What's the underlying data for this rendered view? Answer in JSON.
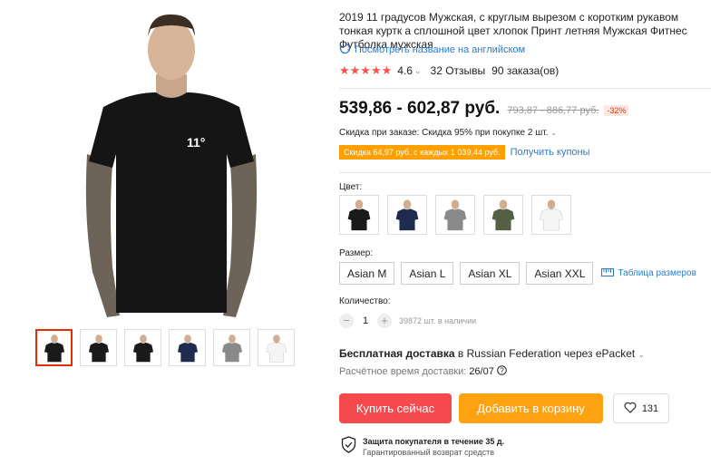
{
  "product": {
    "title": "2019 11 градусов Мужская, с круглым вырезом с коротким рукавом тонкая куртк а сплошной цвет хлопок Принт летняя Мужская Фитнес Футболка мужская",
    "translate_link": "Посмотреть название на английском",
    "stars": "★★★★★",
    "rating": "4.6",
    "reviews": "32 Отзывы",
    "orders": "90 заказа(ов)",
    "price": "539,86 - 602,87 руб.",
    "old_price": "793,87 - 886,77 руб.",
    "discount": "-32%",
    "logo_text": "11°"
  },
  "promo": {
    "bulk_discount": "Скидка при заказе: Скидка 95% при покупке 2 шт.",
    "coupon_tag": "Скидка 64,97 руб. с каждых 1 039,44 руб.",
    "coupon_link": "Получить купоны"
  },
  "options": {
    "color_label": "Цвет:",
    "colors": [
      {
        "name": "black",
        "shirt": "#1a1a1a"
      },
      {
        "name": "navy",
        "shirt": "#1e2b4f"
      },
      {
        "name": "grey",
        "shirt": "#8a8a8a"
      },
      {
        "name": "olive",
        "shirt": "#556043"
      },
      {
        "name": "white",
        "shirt": "#f5f5f5"
      }
    ],
    "size_label": "Размер:",
    "sizes": [
      "Asian M",
      "Asian L",
      "Asian XL",
      "Asian XXL"
    ],
    "size_table": "Таблица размеров",
    "qty_label": "Количество:",
    "qty_value": "1",
    "qty_minus": "−",
    "qty_plus": "+",
    "stock": "39872 шт. в наличии"
  },
  "shipping": {
    "free": "Бесплатная доставка",
    "dest": " в Russian Federation через ePacket",
    "eta_label": "Расчётное время доставки:",
    "eta_date": "26/07"
  },
  "actions": {
    "buy": "Купить сейчас",
    "cart": "Добавить в корзину",
    "wish_count": "131"
  },
  "guarantee": {
    "title": "Защита покупателя в течение 35 д.",
    "subtitle": "Гарантированный возврат средств"
  },
  "thumbnails": [
    {
      "shirt": "#1a1a1a",
      "active": true
    },
    {
      "shirt": "#1a1a1a",
      "active": false
    },
    {
      "shirt": "#1a1a1a",
      "active": false
    },
    {
      "shirt": "#1e2b4f",
      "active": false
    },
    {
      "shirt": "#8a8a8a",
      "active": false
    },
    {
      "shirt": "#f5f5f5",
      "active": false
    }
  ],
  "colors_theme": {
    "accent_red": "#f6494d",
    "accent_orange": "#fda312",
    "link_blue": "#2b7bcc",
    "star_red": "#f7534b"
  }
}
